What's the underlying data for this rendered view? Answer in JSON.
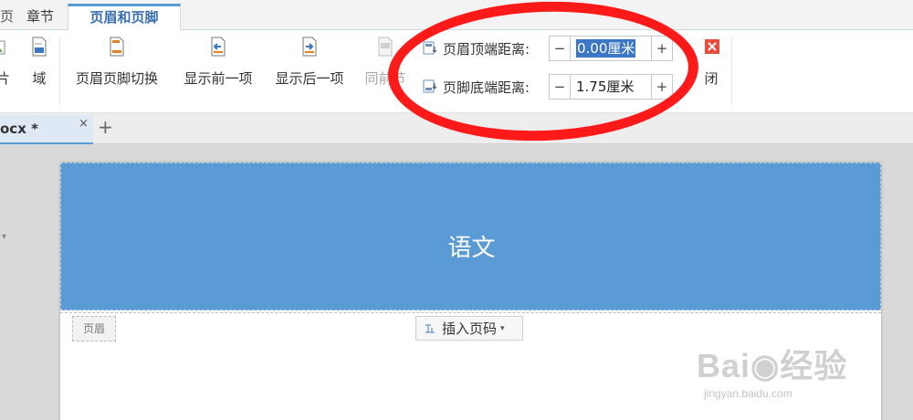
{
  "ribbon_tabs": {
    "clipped": "页",
    "chapter": "章节",
    "active": "页眉和页脚"
  },
  "ribbon": {
    "clipped_picture": "片",
    "field": "域",
    "switch_hf": "页眉页脚切换",
    "show_prev": "显示前一项",
    "show_next": "显示后一项",
    "same_as_prev": "同前节",
    "close": "闭"
  },
  "margins": {
    "top_label": "页眉顶端距离:",
    "top_value": "0.00厘米",
    "bottom_label": "页脚底端距离:",
    "bottom_value": "1.75厘米",
    "minus": "−",
    "plus": "+"
  },
  "doc_tabs": {
    "name": "ocx *",
    "close": "×",
    "new": "+"
  },
  "page": {
    "header_text": "语文",
    "header_tag": "页眉",
    "insert_page_number": "插入页码",
    "caret": "▾"
  },
  "left_arrow": "▾",
  "watermark": {
    "main": "Bai◉经验",
    "sub": "jingyan.baidu.com"
  },
  "colors": {
    "header_band": "#5b9bd5",
    "accent": "#3b6fb0",
    "annotation": "#ff1a1a",
    "selection": "#3c76c6"
  }
}
